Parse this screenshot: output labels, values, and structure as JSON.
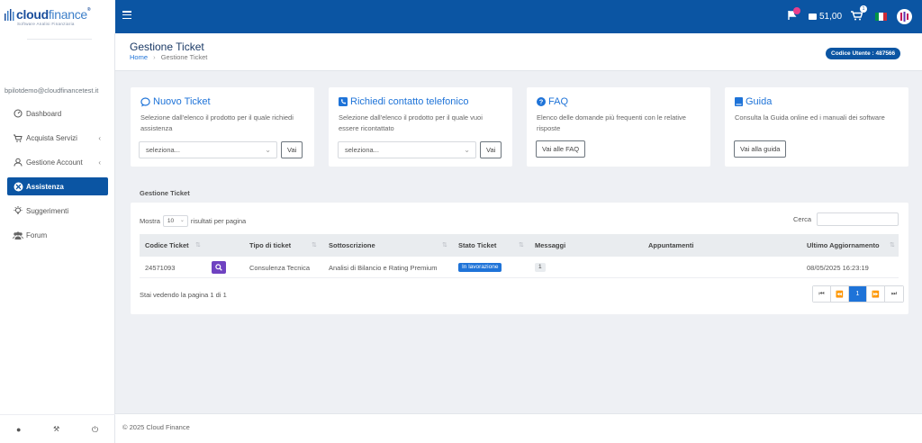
{
  "brand": {
    "name_bold": "cloud",
    "name_light": "finance",
    "tagline": "Software Analisi Finanziaria",
    "registered": "®"
  },
  "topbar": {
    "credit": "51,00",
    "notif_badge": "",
    "cart_badge": "1"
  },
  "user": {
    "email": "bpilotdemo@cloudfinancetest.it",
    "code": "Codice Utente : 487566"
  },
  "sidebar": {
    "items": [
      {
        "label": "Dashboard",
        "icon": "dashboard-icon"
      },
      {
        "label": "Acquista Servizi",
        "icon": "cart-icon"
      },
      {
        "label": "Gestione Account",
        "icon": "user-icon"
      },
      {
        "label": "Assistenza",
        "icon": "lifebuoy-icon"
      },
      {
        "label": "Suggerimenti",
        "icon": "lightbulb-icon"
      },
      {
        "label": "Forum",
        "icon": "users-icon"
      }
    ]
  },
  "page": {
    "title": "Gestione Ticket",
    "breadcrumb_home": "Home",
    "breadcrumb_current": "Gestione Ticket"
  },
  "cards": [
    {
      "title": "Nuovo Ticket",
      "desc": "Selezione dall'elenco il prodotto per il quale richiedi assistenza",
      "select": "seleziona...",
      "button": "Vai"
    },
    {
      "title": "Richiedi contatto telefonico",
      "desc": "Selezione dall'elenco il prodotto per il quale vuoi essere ricontattato",
      "select": "seleziona...",
      "button": "Vai"
    },
    {
      "title": "FAQ",
      "desc": "Elenco delle domande più frequenti con le relative risposte",
      "button": "Vai alle FAQ"
    },
    {
      "title": "Guida",
      "desc": "Consulta la Guida online ed i manuali dei software",
      "button": "Vai alla guida"
    }
  ],
  "table": {
    "section_label": "Gestione Ticket",
    "show_prefix": "Mostra",
    "page_size": "10",
    "show_suffix": "risultati per pagina",
    "search_label": "Cerca",
    "columns": [
      "Codice Ticket",
      "Tipo di ticket",
      "Sottoscrizione",
      "Stato Ticket",
      "Messaggi",
      "Appuntamenti",
      "Ultimo Aggiornamento"
    ],
    "rows": [
      {
        "code": "24571093",
        "type": "Consulenza Tecnica",
        "subscription": "Analisi di Bilancio e Rating Premium",
        "status": "In lavorazione",
        "messages": "1",
        "appointments": "",
        "updated": "08/05/2025 16:23:19"
      }
    ],
    "info": "Stai vedendo la pagina 1 di 1",
    "current_page": "1"
  },
  "footer": {
    "text": "© 2025 Cloud Finance"
  }
}
